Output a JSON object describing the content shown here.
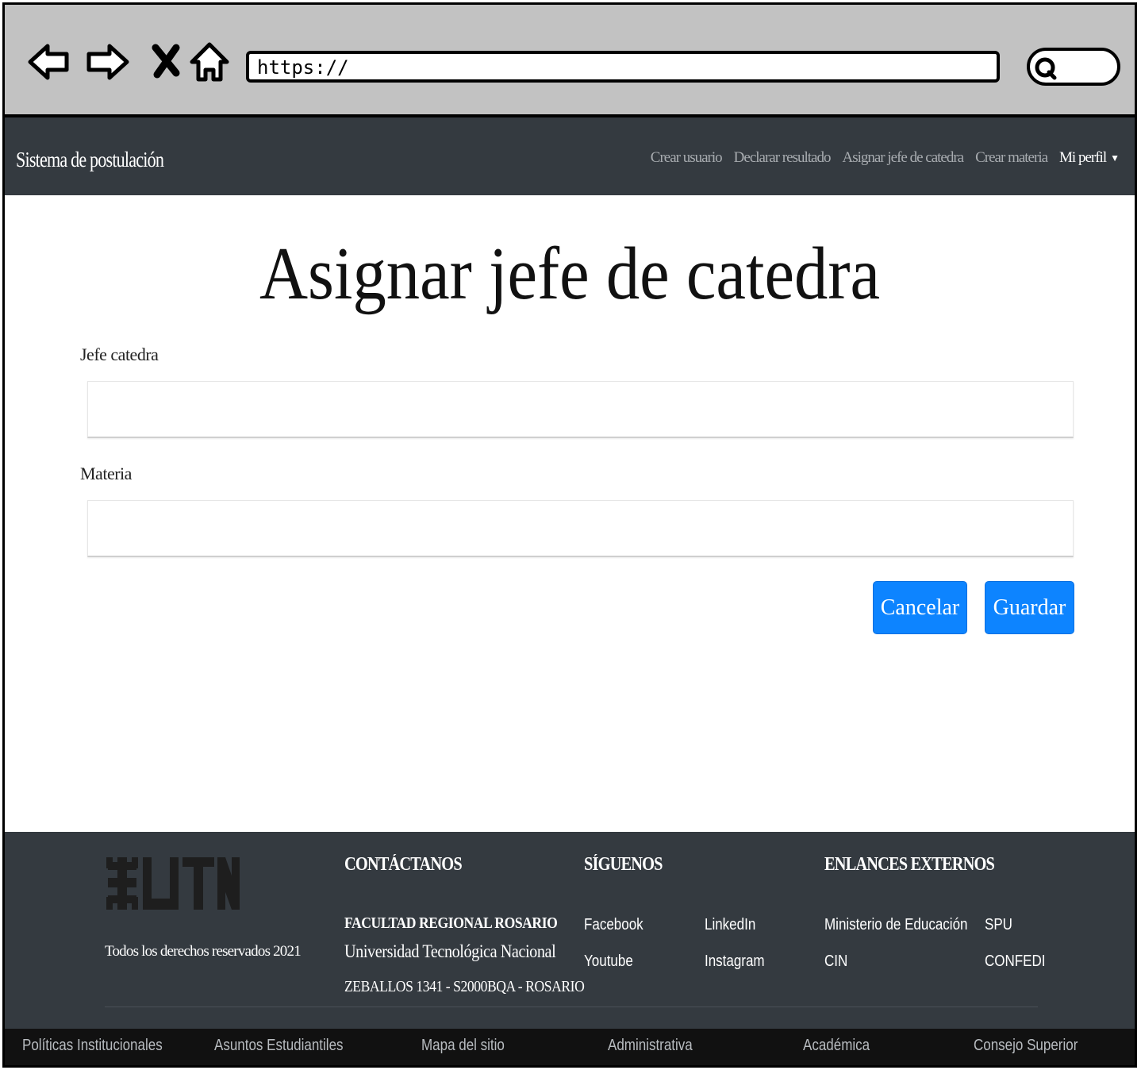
{
  "browser": {
    "url": "https://",
    "icons": [
      "back-arrow-icon",
      "forward-arrow-icon",
      "close-icon",
      "home-icon",
      "search-icon"
    ]
  },
  "navbar": {
    "brand": "Sistema de postulación",
    "links": [
      "Crear usuario",
      "Declarar resultado",
      "Asignar jefe de catedra",
      "Crear materia"
    ],
    "profile": "Mi perfil"
  },
  "main": {
    "title": "Asignar jefe de catedra",
    "jefe_label": "Jefe catedra",
    "jefe_value": "",
    "materia_label": "Materia",
    "materia_value": "",
    "cancel_label": "Cancelar",
    "save_label": "Guardar"
  },
  "footer": {
    "rights": "Todos los derechos reservados 2021",
    "contact_heading": "CONTÁCTANOS",
    "faculty": "FACULTAD REGIONAL ROSARIO",
    "university": "Universidad Tecnológica Nacional",
    "address": "ZEBALLOS 1341 - S2000BQA - ROSARIO",
    "follow_heading": "SÍGUENOS",
    "social": [
      "Facebook",
      "LinkedIn",
      "Youtube",
      "Instagram"
    ],
    "external_heading": "ENLANCES EXTERNOS",
    "external": [
      "Ministerio de Educación",
      "SPU",
      "CIN",
      "CONFEDI"
    ],
    "bottom_links": [
      "Políticas Institucionales",
      "Asuntos Estudiantiles",
      "Mapa del sitio",
      "Administrativa",
      "Académica",
      "Consejo Superior"
    ]
  },
  "colors": {
    "navbar_bg": "#343a40",
    "button_bg": "#0d84ff",
    "chrome_bg": "#c2c2c2",
    "bottom_bar_bg": "#111111"
  }
}
